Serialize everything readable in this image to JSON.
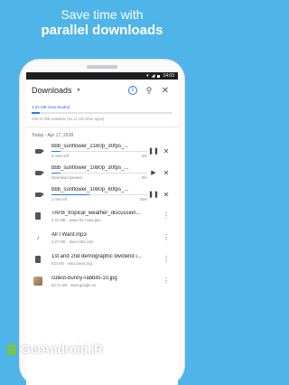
{
  "promo": {
    "line1": "Save time with",
    "line2": "parallel downloads"
  },
  "statusbar": {
    "time": "14:03"
  },
  "appbar": {
    "title": "Downloads"
  },
  "storage": {
    "downloaded": "4.94 MB downloaded",
    "used_fraction": 0.06,
    "detail": "469.32 MB available (52.11 GB other apps)"
  },
  "date_header": "Today - Apr 17, 2018",
  "items": [
    {
      "name": "bbb_sunflower_2160p_30fps_...",
      "status": "5 mins left",
      "percent": "9%",
      "progress": 0.09,
      "action": "pause"
    },
    {
      "name": "bbb_sunflower_1080p_30fps_...",
      "status": "Download paused",
      "percent": "9%",
      "progress": 0.09,
      "action": "resume"
    },
    {
      "name": "bbb_sunflower_1080p_60fps_...",
      "status": "1 min left",
      "percent": "40%",
      "progress": 0.4,
      "action": "pause"
    },
    {
      "name": "TAFB_tropical_weather_discussion...",
      "detail": "2.31 MB · www.nhc.noaa.gov"
    },
    {
      "name": "All I Want.mp3",
      "detail": "2.27 MB · dora-robo.com"
    },
    {
      "name": "1st and 2nd demographic dividend i...",
      "detail": "524 KB · ntaccounts.org"
    },
    {
      "name": "cutest-bunny-rabbits-10.jpg",
      "detail": "62.71 KB · www.google.ee"
    }
  ],
  "watermark": "GetAndroid.iR",
  "colors": {
    "accent": "#2a7ae4",
    "background": "#4fb4e7"
  }
}
